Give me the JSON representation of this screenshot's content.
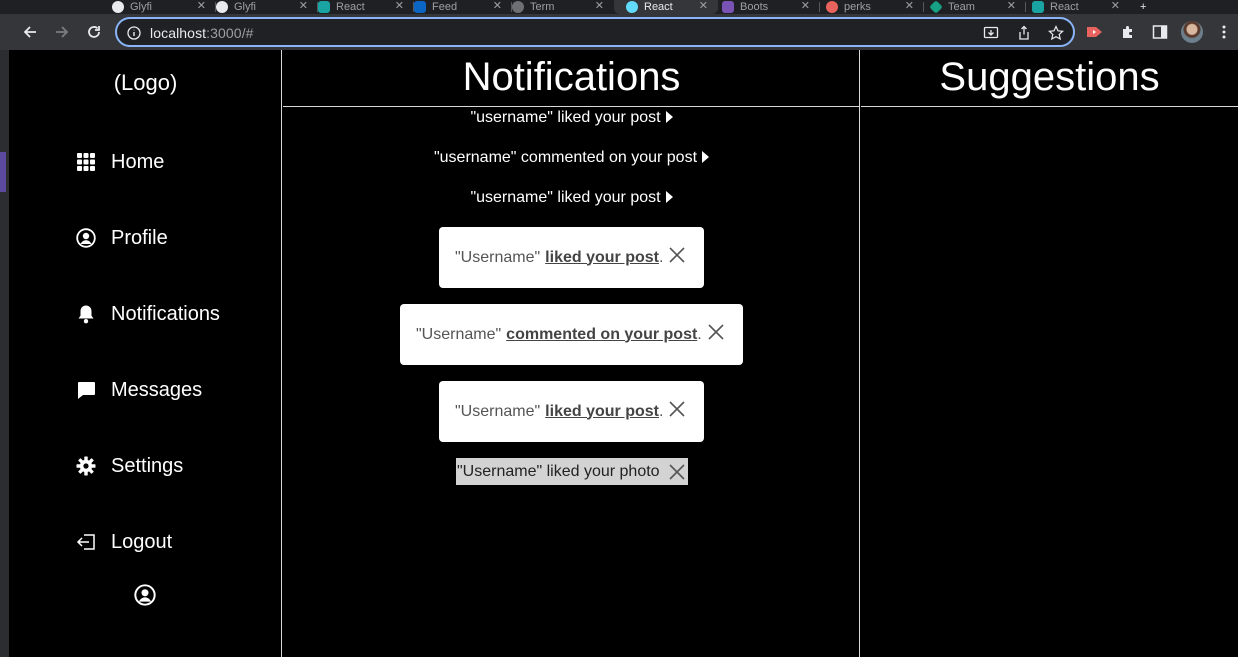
{
  "browser": {
    "url_host": "localhost",
    "url_rest": ":3000/#",
    "tabs": [
      {
        "label": "Glyfi",
        "active": false
      },
      {
        "label": "Glyfi",
        "active": false
      },
      {
        "label": "React",
        "active": false
      },
      {
        "label": "Feed",
        "active": false
      },
      {
        "label": "Term",
        "active": false
      },
      {
        "label": "React",
        "active": true
      },
      {
        "label": "Boots",
        "active": false
      },
      {
        "label": "perks",
        "active": false
      },
      {
        "label": "Team",
        "active": false
      },
      {
        "label": "React",
        "active": false
      }
    ]
  },
  "sidebar": {
    "logo": "(Logo)",
    "items": [
      {
        "label": "Home",
        "icon": "grid-icon"
      },
      {
        "label": "Profile",
        "icon": "user-circle-icon"
      },
      {
        "label": "Notifications",
        "icon": "bell-icon"
      },
      {
        "label": "Messages",
        "icon": "message-icon"
      },
      {
        "label": "Settings",
        "icon": "gear-icon"
      },
      {
        "label": "Logout",
        "icon": "logout-icon"
      }
    ]
  },
  "notifications": {
    "title": "Notifications",
    "text_items": [
      "\"username\" liked your post",
      "\"username\" commented on your post",
      "\"username\" liked your post"
    ],
    "cards": [
      {
        "user": "\"Username\"",
        "action": "liked your post",
        "end": "."
      },
      {
        "user": "\"Username\"",
        "action": "commented on your post",
        "end": "."
      },
      {
        "user": "\"Username\"",
        "action": "liked your post",
        "end": "."
      }
    ],
    "photo_notice": "\"Username\" liked your photo"
  },
  "suggestions": {
    "title": "Suggestions"
  }
}
